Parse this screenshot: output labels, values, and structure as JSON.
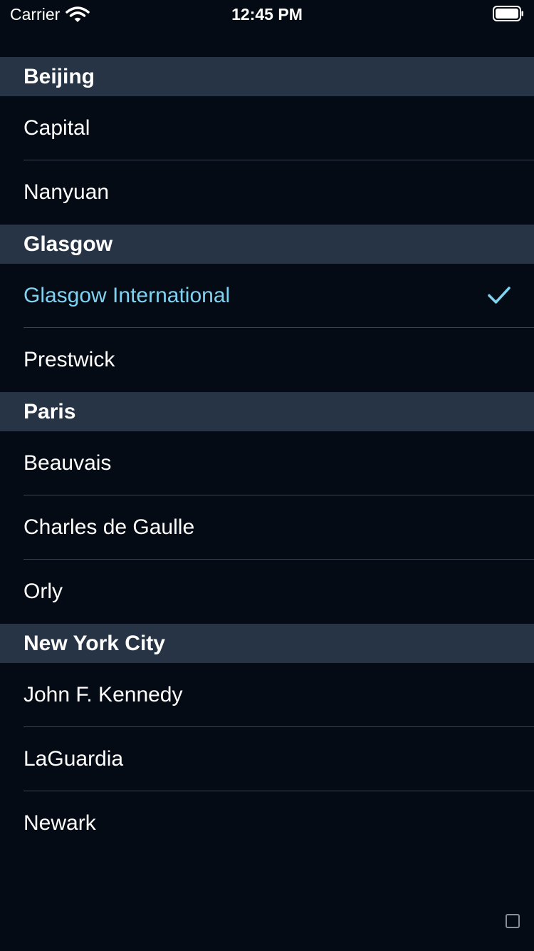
{
  "status_bar": {
    "carrier": "Carrier",
    "time": "12:45 PM"
  },
  "colors": {
    "background": "#050b14",
    "section_header": "#263446",
    "accent": "#7fd3f2",
    "separator": "#3a4250"
  },
  "sections": [
    {
      "title": "Beijing",
      "rows": [
        {
          "label": "Capital"
        },
        {
          "label": "Nanyuan"
        }
      ]
    },
    {
      "title": "Glasgow",
      "rows": [
        {
          "label": "Glasgow International",
          "selected": true,
          "icon": "checkmark-icon"
        },
        {
          "label": "Prestwick"
        }
      ]
    },
    {
      "title": "Paris",
      "rows": [
        {
          "label": "Beauvais"
        },
        {
          "label": "Charles de Gaulle"
        },
        {
          "label": "Orly"
        }
      ]
    },
    {
      "title": "New York City",
      "rows": [
        {
          "label": "John F. Kennedy"
        },
        {
          "label": "LaGuardia"
        },
        {
          "label": "Newark"
        }
      ]
    }
  ]
}
